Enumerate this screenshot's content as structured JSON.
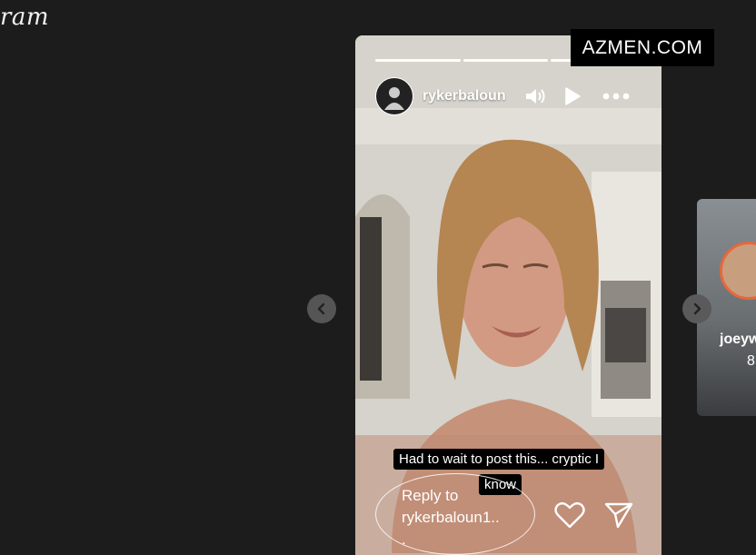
{
  "app": {
    "logo_text": "ram"
  },
  "watermark": "AZMEN.COM",
  "story": {
    "username": "rykerbaloun",
    "progress": {
      "segments": 3,
      "completed": 3
    },
    "caption_line1": "Had to wait to post this... cryptic I",
    "caption_line2": "know",
    "reply_placeholder": "Reply to\nrykerbaloun1..\n.",
    "icons": [
      "volume-icon",
      "play-icon",
      "more-icon",
      "heart-icon",
      "send-icon"
    ]
  },
  "next_story": {
    "username": "joeyw",
    "subtext": "8"
  },
  "colors": {
    "background": "#1c1c1c",
    "ring_accent": "#e6683c",
    "caption_bg": "#000000"
  }
}
